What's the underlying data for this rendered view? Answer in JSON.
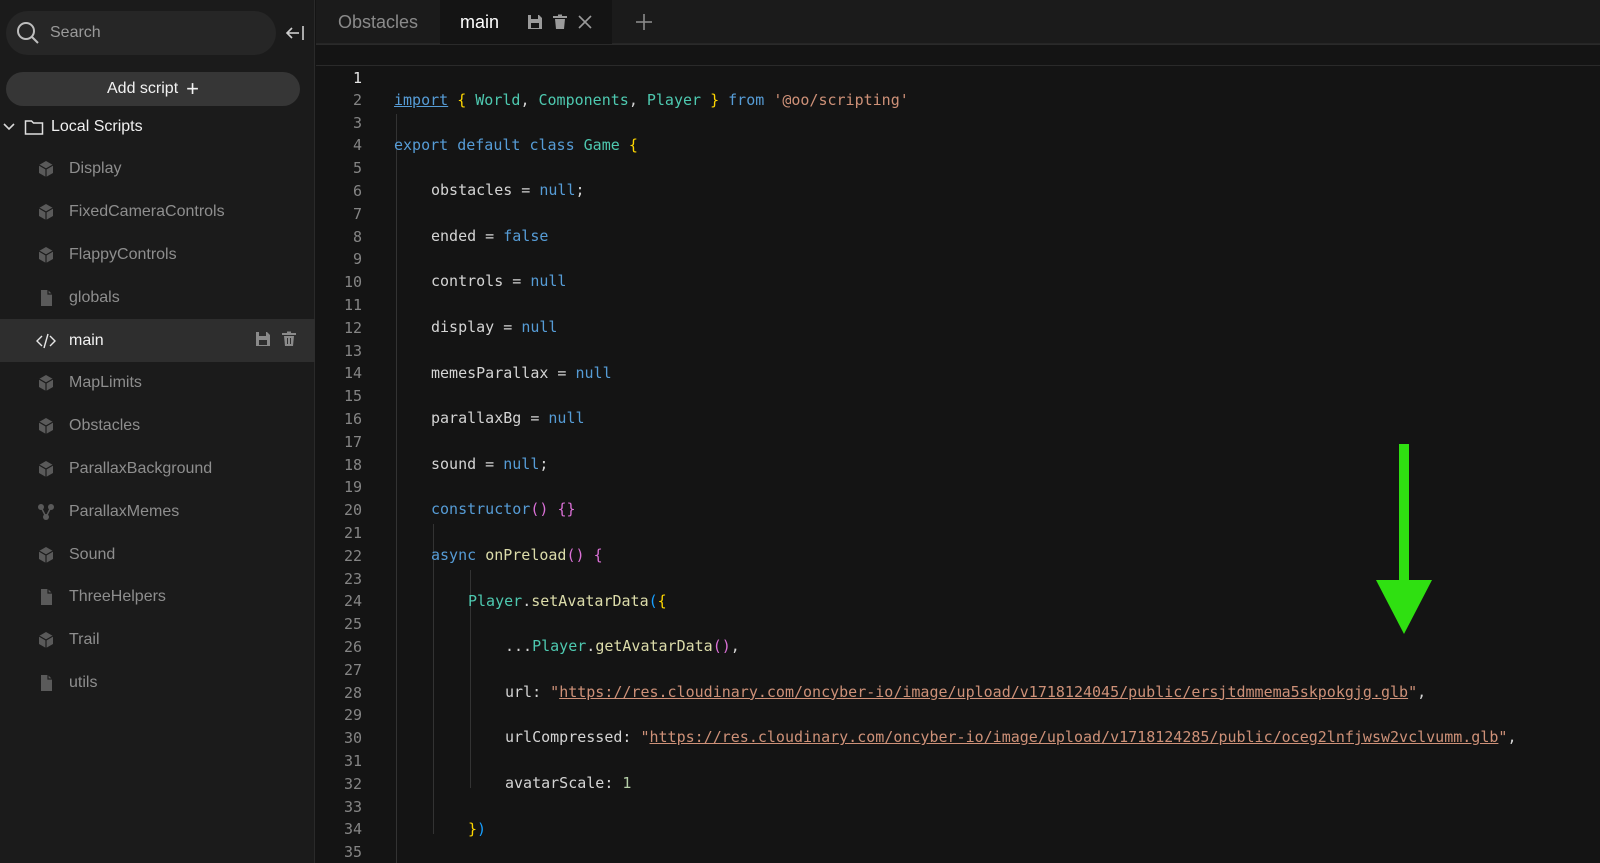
{
  "sidebar": {
    "search_label": "Search",
    "add_script_label": "Add script",
    "folder_label": "Local Scripts",
    "files": [
      {
        "label": "Display",
        "icon": "cube-icon"
      },
      {
        "label": "FixedCameraControls",
        "icon": "cube-icon"
      },
      {
        "label": "FlappyControls",
        "icon": "cube-icon"
      },
      {
        "label": "globals",
        "icon": "file-icon"
      },
      {
        "label": "main",
        "icon": "code-icon",
        "active": true
      },
      {
        "label": "MapLimits",
        "icon": "cube-icon"
      },
      {
        "label": "Obstacles",
        "icon": "cube-icon"
      },
      {
        "label": "ParallaxBackground",
        "icon": "cube-icon"
      },
      {
        "label": "ParallaxMemes",
        "icon": "nodes-icon"
      },
      {
        "label": "Sound",
        "icon": "cube-icon"
      },
      {
        "label": "ThreeHelpers",
        "icon": "file-icon"
      },
      {
        "label": "Trail",
        "icon": "cube-icon"
      },
      {
        "label": "utils",
        "icon": "file-icon"
      }
    ]
  },
  "tabs": {
    "obstacles_label": "Obstacles",
    "main_label": "main"
  },
  "editor": {
    "line_numbers": [
      "1",
      "2",
      "3",
      "4",
      "5",
      "6",
      "7",
      "8",
      "9",
      "10",
      "11",
      "12",
      "13",
      "14",
      "15",
      "16",
      "17",
      "18",
      "19",
      "20",
      "21",
      "22",
      "23",
      "24",
      "25",
      "26",
      "27",
      "28",
      "29",
      "30",
      "31",
      "32",
      "33",
      "34",
      "35"
    ],
    "tokens": {
      "import": "import",
      "world": "World",
      "components": "Components",
      "player": "Player",
      "from": "from",
      "module": "'@oo/scripting'",
      "export_default_class": "export default class",
      "game": "Game",
      "obstacles": "obstacles",
      "ended": "ended",
      "controls": "controls",
      "display": "display",
      "memes_parallax": "memesParallax",
      "parallax_bg": "parallaxBg",
      "sound": "sound",
      "null": "null",
      "false": "false",
      "constructor": "constructor",
      "async": "async",
      "on_preload": "onPreload",
      "player_ref": "Player",
      "set_avatar_data": "setAvatarData",
      "get_avatar_data": "getAvatarData",
      "url_key": "url",
      "url_value": "https://res.cloudinary.com/oncyber-io/image/upload/v1718124045/public/ersjtdmmema5skpokgjg.glb",
      "url_compressed_key": "urlCompressed",
      "url_compressed_value": "https://res.cloudinary.com/oncyber-io/image/upload/v1718124285/public/oceg2lnfjwsw2vclvumm.glb",
      "avatar_scale_key": "avatarScale",
      "avatar_scale_value": "1"
    }
  },
  "colors": {
    "keyword": "#569cd6",
    "type": "#4ec9b0",
    "string": "#ce9178",
    "arrow": "#2fe011"
  }
}
